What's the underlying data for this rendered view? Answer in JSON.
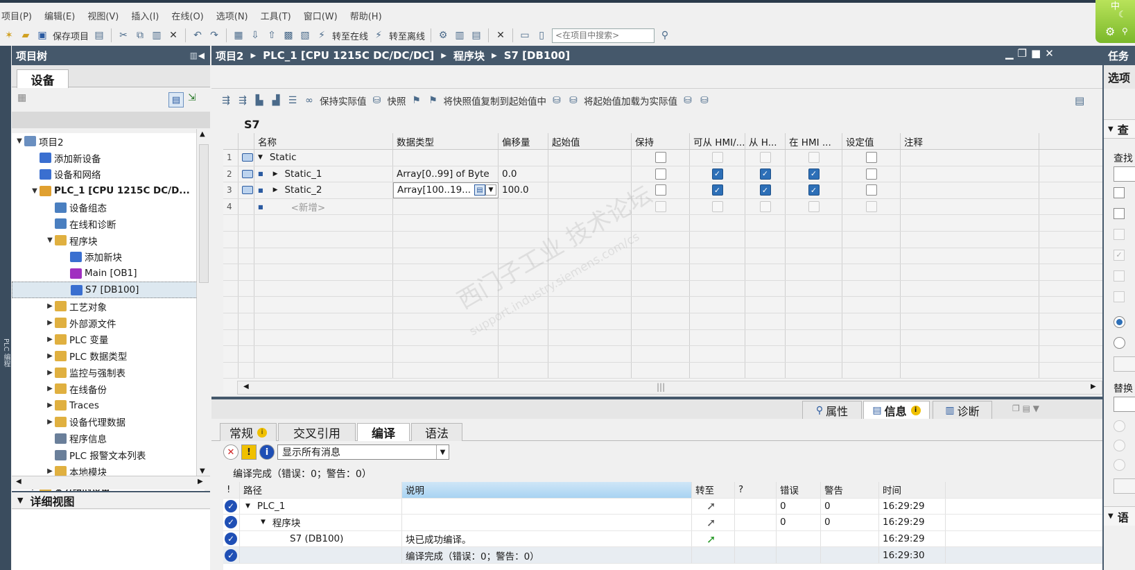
{
  "menu": [
    "项目(P)",
    "编辑(E)",
    "视图(V)",
    "插入(I)",
    "在线(O)",
    "选项(N)",
    "工具(T)",
    "窗口(W)",
    "帮助(H)"
  ],
  "toolbar": {
    "save_label": "保存项目",
    "go_online": "转至在线",
    "go_offline": "转至离线",
    "search_placeholder": "<在项目中搜索>"
  },
  "project_tree": {
    "title": "项目树",
    "tab": "设备",
    "items": [
      {
        "label": "项目2",
        "indent": 0,
        "expander": "open",
        "icon": "project-icon",
        "color": "#6a8fc0"
      },
      {
        "label": "添加新设备",
        "indent": 1,
        "expander": "",
        "icon": "add-device-icon",
        "color": "#3a6fd0"
      },
      {
        "label": "设备和网络",
        "indent": 1,
        "expander": "",
        "icon": "network-icon",
        "color": "#3a6fd0"
      },
      {
        "label": "PLC_1 [CPU 1215C DC/D...",
        "indent": 1,
        "expander": "open",
        "icon": "plc-icon",
        "color": "#e0a030",
        "bold": true
      },
      {
        "label": "设备组态",
        "indent": 2,
        "expander": "",
        "icon": "device-config-icon",
        "color": "#4a7fc0"
      },
      {
        "label": "在线和诊断",
        "indent": 2,
        "expander": "",
        "icon": "diagnostics-icon",
        "color": "#4a7fc0"
      },
      {
        "label": "程序块",
        "indent": 2,
        "expander": "open",
        "icon": "folder-icon",
        "color": "#e0b040"
      },
      {
        "label": "添加新块",
        "indent": 3,
        "expander": "",
        "icon": "add-block-icon",
        "color": "#3a6fd0"
      },
      {
        "label": "Main [OB1]",
        "indent": 3,
        "expander": "",
        "icon": "ob-icon",
        "color": "#a030c0"
      },
      {
        "label": "S7 [DB100]",
        "indent": 3,
        "expander": "",
        "icon": "db-icon",
        "color": "#3a6fd0",
        "selected": true
      },
      {
        "label": "工艺对象",
        "indent": 2,
        "expander": "closed",
        "icon": "tech-object-icon",
        "color": "#e0b040"
      },
      {
        "label": "外部源文件",
        "indent": 2,
        "expander": "closed",
        "icon": "source-file-icon",
        "color": "#e0b040"
      },
      {
        "label": "PLC 变量",
        "indent": 2,
        "expander": "closed",
        "icon": "plc-tags-icon",
        "color": "#e0b040"
      },
      {
        "label": "PLC 数据类型",
        "indent": 2,
        "expander": "closed",
        "icon": "data-type-icon",
        "color": "#e0b040"
      },
      {
        "label": "监控与强制表",
        "indent": 2,
        "expander": "closed",
        "icon": "watch-table-icon",
        "color": "#e0b040"
      },
      {
        "label": "在线备份",
        "indent": 2,
        "expander": "closed",
        "icon": "backup-icon",
        "color": "#e0b040"
      },
      {
        "label": "Traces",
        "indent": 2,
        "expander": "closed",
        "icon": "traces-icon",
        "color": "#e0b040"
      },
      {
        "label": "设备代理数据",
        "indent": 2,
        "expander": "closed",
        "icon": "proxy-data-icon",
        "color": "#e0b040"
      },
      {
        "label": "程序信息",
        "indent": 2,
        "expander": "",
        "icon": "program-info-icon",
        "color": "#6a7f9a"
      },
      {
        "label": "PLC 报警文本列表",
        "indent": 2,
        "expander": "",
        "icon": "alarm-text-icon",
        "color": "#6a7f9a"
      },
      {
        "label": "本地模块",
        "indent": 2,
        "expander": "closed",
        "icon": "local-modules-icon",
        "color": "#e0b040"
      },
      {
        "label": "未分组的设备",
        "indent": 1,
        "expander": "closed",
        "icon": "ungrouped-icon",
        "color": "#e0b040",
        "bold": true
      }
    ],
    "detail_view": "详细视图"
  },
  "editor": {
    "breadcrumb": [
      "项目2",
      "PLC_1 [CPU 1215C DC/DC/DC]",
      "程序块",
      "S7 [DB100]"
    ],
    "toolbar": {
      "keep_actual": "保持实际值",
      "snapshot": "快照",
      "copy_snapshot": "将快照值复制到起始值中",
      "load_start": "将起始值加载为实际值"
    },
    "db_name": "S7",
    "columns": [
      "名称",
      "数据类型",
      "偏移量",
      "起始值",
      "保持",
      "可从 HMI/...",
      "从 H...",
      "在 HMI ...",
      "设定值",
      "注释"
    ],
    "rows": [
      {
        "num": "1",
        "name": "Static",
        "type": "",
        "offset": "",
        "start": "",
        "retain": false,
        "hmi_access": false,
        "hmi_visible": false,
        "hmi_engineer": false,
        "setpoint": false,
        "level": 0
      },
      {
        "num": "2",
        "name": "Static_1",
        "type": "Array[0..99] of Byte",
        "offset": "0.0",
        "start": "",
        "retain": false,
        "hmi_access": true,
        "hmi_visible": true,
        "hmi_engineer": true,
        "setpoint": false,
        "level": 1
      },
      {
        "num": "3",
        "name": "Static_2",
        "type": "Array[100..19...",
        "offset": "100.0",
        "start": "",
        "retain": false,
        "hmi_access": true,
        "hmi_visible": true,
        "hmi_engineer": true,
        "setpoint": false,
        "level": 1
      },
      {
        "num": "4",
        "name": "<新增>",
        "type": "",
        "offset": "",
        "start": "",
        "retain": false,
        "hmi_access": false,
        "hmi_visible": false,
        "hmi_engineer": false,
        "setpoint": false,
        "level": 1,
        "placeholder": true
      }
    ],
    "watermark": "西门子工业 技术论坛",
    "watermark_url": "support.industry.siemens.com/cs"
  },
  "inspector": {
    "top_tabs": [
      "属性",
      "信息",
      "诊断"
    ],
    "tabs": [
      "常规",
      "交叉引用",
      "编译",
      "语法"
    ],
    "active_tab": "编译",
    "filter": "显示所有消息",
    "summary": "编译完成（错误：0；警告：0）",
    "columns": [
      "!",
      "路径",
      "说明",
      "转至",
      "?",
      "错误",
      "警告",
      "时间"
    ],
    "messages": [
      {
        "path": "PLC_1",
        "indent": 0,
        "desc": "",
        "goto": true,
        "errors": "0",
        "warnings": "0",
        "time": "16:29:29"
      },
      {
        "path": "程序块",
        "indent": 1,
        "desc": "",
        "goto": true,
        "errors": "0",
        "warnings": "0",
        "time": "16:29:29"
      },
      {
        "path": "S7 (DB100)",
        "indent": 2,
        "desc": "块已成功编译。",
        "goto": true,
        "errors": "",
        "warnings": "",
        "time": "16:29:29"
      },
      {
        "path": "",
        "indent": 0,
        "desc": "编译完成（错误：0；警告：0）",
        "goto": false,
        "errors": "",
        "warnings": "",
        "time": "16:29:30"
      }
    ]
  },
  "right_panel": {
    "title": "任务",
    "options": "选项",
    "find": "查",
    "find_label": "查找",
    "replace_label": "替换",
    "lang": "语"
  },
  "colors": {
    "header_bg": "#45586b",
    "checkbox_on": "#2d6fb7",
    "selection": "#dde8f0"
  }
}
